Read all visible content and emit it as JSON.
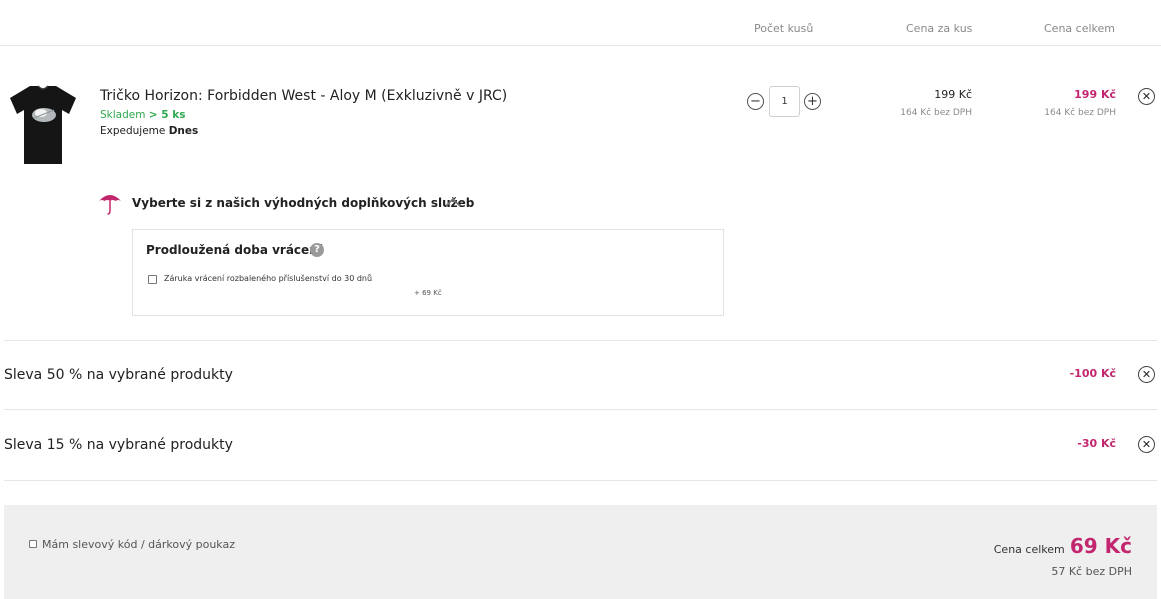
{
  "columns": {
    "quantity": "Počet kusů",
    "unit_price": "Cena za kus",
    "total_price": "Cena celkem"
  },
  "product": {
    "name": "Tričko Horizon: Forbidden West - Aloy M (Exkluzivně v JRC)",
    "stock_label": "Skladem",
    "stock_value": "> 5 ks",
    "shipping_label": "Expedujeme",
    "shipping_value": "Dnes",
    "quantity": "1",
    "unit_price": "199 Kč",
    "unit_price_net": "164 Kč bez DPH",
    "total_price": "199 Kč",
    "total_price_net": "164 Kč bez DPH"
  },
  "services": {
    "title": "Vyberte si z našich výhodných doplňkových služeb",
    "box_title": "Prodloužená doba vrácení",
    "help_glyph": "?",
    "option_label": "Záruka vrácení rozbaleného příslušenství do 30 dnů",
    "option_price": "+ 69 Kč"
  },
  "discounts": [
    {
      "label": "Sleva 50 % na vybrané produkty",
      "value": "-100 Kč"
    },
    {
      "label": "Sleva 15 % na vybrané produkty",
      "value": "-30 Kč"
    }
  ],
  "footer": {
    "coupon_label": "Mám slevový kód / dárkový poukaz",
    "total_label": "Cena celkem",
    "total_value": "69 Kč",
    "total_net": "57 Kč bez DPH"
  },
  "colors": {
    "accent": "#c2266f",
    "stock_green": "#2fa84f",
    "footer_bg": "#efefef"
  },
  "icons": {
    "remove": "close-icon",
    "services": "umbrella-icon",
    "collapse": "chevron-up-icon",
    "help": "help-icon"
  }
}
